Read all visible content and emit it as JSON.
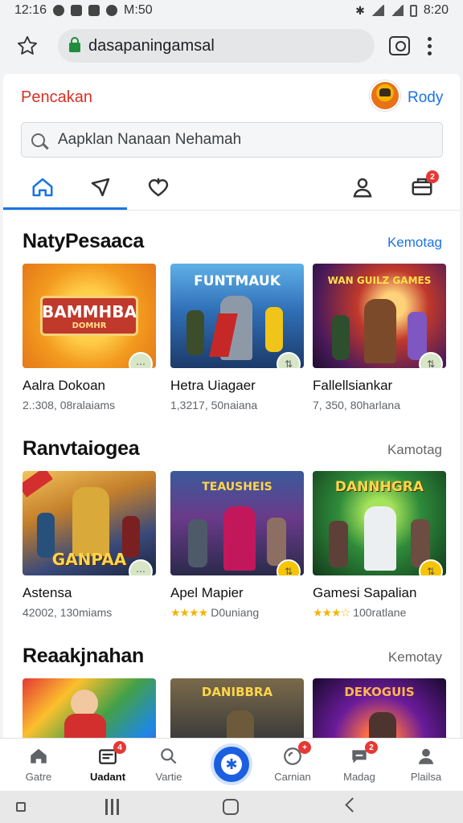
{
  "status_bar": {
    "time": "12:16",
    "middle_text": "M:50",
    "right_time": "8:20"
  },
  "browser": {
    "url": "dasapaningamsal"
  },
  "header": {
    "brand": "Pencakan",
    "username": "Rody"
  },
  "search": {
    "placeholder": "Aapklan Nanaan Nehamah"
  },
  "tabs": {
    "bag_badge": "2"
  },
  "sections": [
    {
      "title": "NatyPesaaca",
      "more": "Kemotag",
      "more_color": "#1a73e8",
      "cards": [
        {
          "name": "Aalra Dokoan",
          "meta": "2.:308, 08ralaiams",
          "art_text": "BAMMHBA",
          "art_sub": "DOMHR"
        },
        {
          "name": "Hetra Uiagaer",
          "meta": "1,3217, 50naiana",
          "art_text": "FUNTMAUK"
        },
        {
          "name": "Fallellsiankar",
          "meta": "7, 350, 80harlana",
          "art_text": "WAN GUILZ GAMES"
        }
      ]
    },
    {
      "title": "Ranvtaiogea",
      "more": "Kamotag",
      "more_color": "#666666",
      "cards": [
        {
          "name": "Astensa",
          "meta": "42002, 130miams",
          "art_text": "GANPAA"
        },
        {
          "name": "Apel Mapier",
          "meta": "D0uniang",
          "rating_stars": "★★★★",
          "art_text": "TEAUSHEIS"
        },
        {
          "name": "Gamesi Sapalian",
          "meta": "100ratlane",
          "rating_stars": "★★★☆",
          "art_text": "DANNHGRA"
        }
      ]
    },
    {
      "title": "Reaakjnahan",
      "more": "Kemotay",
      "more_color": "#666666",
      "cards": [
        {
          "name": "",
          "meta": "",
          "art_text": ""
        },
        {
          "name": "",
          "meta": "",
          "art_text": "DANIBBRA"
        },
        {
          "name": "",
          "meta": "",
          "art_text": "DEKOGUIS"
        }
      ]
    }
  ],
  "bottom_nav": [
    {
      "label": "Gatre",
      "icon": "home-icon"
    },
    {
      "label": "Uadant",
      "icon": "updates-icon",
      "badge": "4",
      "active": true
    },
    {
      "label": "Vartie",
      "icon": "search-icon"
    },
    {
      "label": "",
      "icon": "star-fab-icon"
    },
    {
      "label": "Carnian",
      "icon": "cart-icon",
      "badge": "+"
    },
    {
      "label": "Madag",
      "icon": "chat-icon",
      "badge": "2"
    },
    {
      "label": "Plailsa",
      "icon": "profile-icon"
    }
  ],
  "colors": {
    "accent": "#1a73e8",
    "brand": "#d93025",
    "badge": "#e53935"
  }
}
